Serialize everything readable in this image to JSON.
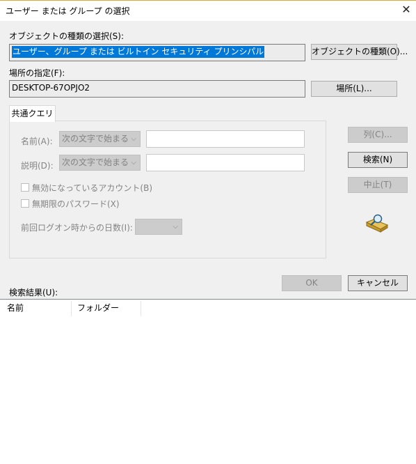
{
  "window": {
    "title": "ユーザー または グループ の選択",
    "close_glyph": "✕"
  },
  "object_types": {
    "label": "オブジェクトの種類の選択(S):",
    "value": "ユーザー、グループ または ビルトイン セキュリティ プリンシパル",
    "button": "オブジェクトの種類(O)..."
  },
  "location": {
    "label": "場所の指定(F):",
    "value": "DESKTOP-67OPJO2",
    "button": "場所(L)..."
  },
  "query": {
    "tab_label": "共通クエリ",
    "name_label": "名前(A):",
    "name_mode": "次の文字で始まる",
    "desc_label": "説明(D):",
    "desc_mode": "次の文字で始まる",
    "disabled_accounts": "無効になっているアカウント(B)",
    "non_expiring_pw": "無期限のパスワード(X)",
    "days_since_logon": "前回ログオン時からの日数(I):",
    "combo_arrow": "⌵"
  },
  "side_buttons": {
    "columns": "列(C)...",
    "search": "検索(N)",
    "stop": "中止(T)"
  },
  "footer": {
    "ok": "OK",
    "cancel": "キャンセル"
  },
  "results": {
    "label": "検索結果(U):",
    "columns": [
      "名前",
      "フォルダー"
    ]
  }
}
